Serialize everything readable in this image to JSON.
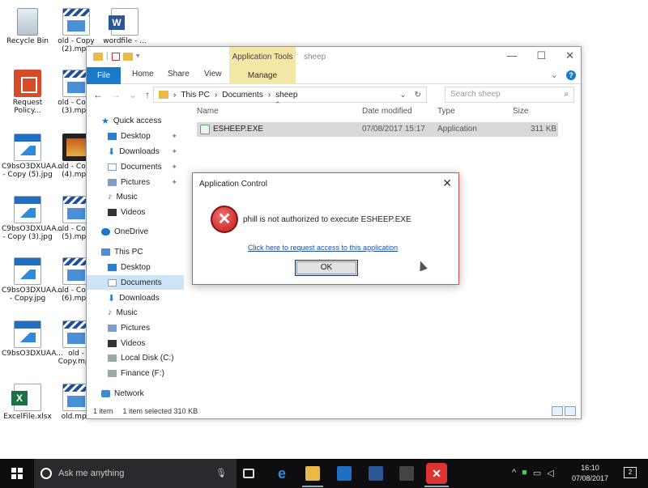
{
  "desktop": {
    "icons": [
      {
        "label": "Recycle Bin"
      },
      {
        "label": "old - Copy (2).mp4"
      },
      {
        "label": "wordfile - ..."
      },
      {
        "label": "Request Policy..."
      },
      {
        "label": "old - Copy (3).mp4"
      },
      {
        "label": "C9bsO3DXUAA... - Copy (5).jpg"
      },
      {
        "label": "old - Copy (4).mp4"
      },
      {
        "label": "C9bsO3DXUAA... - Copy (3).jpg"
      },
      {
        "label": "old - Copy (5).mp4"
      },
      {
        "label": "C9bsO3DXUAA... - Copy.jpg"
      },
      {
        "label": "old - Copy (6).mp4"
      },
      {
        "label": "C9bsO3DXUAA..."
      },
      {
        "label": "old - Copy.mp4"
      },
      {
        "label": "ExcelFile.xlsx"
      },
      {
        "label": "old.mp4"
      }
    ]
  },
  "explorer": {
    "title": "sheep",
    "context_tab": "Application Tools",
    "ribbon_tabs": {
      "file": "File",
      "home": "Home",
      "share": "Share",
      "view": "View",
      "manage": "Manage"
    },
    "breadcrumb": [
      "This PC",
      "Documents",
      "sheep"
    ],
    "search_placeholder": "Search sheep",
    "nav": {
      "quick_access": "Quick access",
      "desktop": "Desktop",
      "downloads": "Downloads",
      "documents": "Documents",
      "pictures": "Pictures",
      "music": "Music",
      "videos": "Videos",
      "onedrive": "OneDrive",
      "this_pc": "This PC",
      "pc_desktop": "Desktop",
      "pc_documents": "Documents",
      "pc_downloads": "Downloads",
      "pc_music": "Music",
      "pc_pictures": "Pictures",
      "pc_videos": "Videos",
      "local_disk": "Local Disk (C:)",
      "finance": "Finance (F:)",
      "network": "Network"
    },
    "columns": {
      "name": "Name",
      "date": "Date modified",
      "type": "Type",
      "size": "Size"
    },
    "files": [
      {
        "name": "ESHEEP.EXE",
        "date": "07/08/2017 15:17",
        "type": "Application",
        "size": "311 KB"
      }
    ],
    "status": {
      "items": "1 item",
      "selected": "1 item selected 310 KB"
    }
  },
  "dialog": {
    "title": "Application Control",
    "message": "phill is not authorized to execute ESHEEP.EXE",
    "link": "Click here to request access to this application",
    "ok_label": "OK"
  },
  "taskbar": {
    "search_placeholder": "Ask me anything",
    "time": "16:10",
    "date": "07/08/2017",
    "notifications": "2"
  },
  "colors": {
    "accent": "#1979ca",
    "dialog_border": "#e05050",
    "taskbar": "#0e0e10"
  }
}
